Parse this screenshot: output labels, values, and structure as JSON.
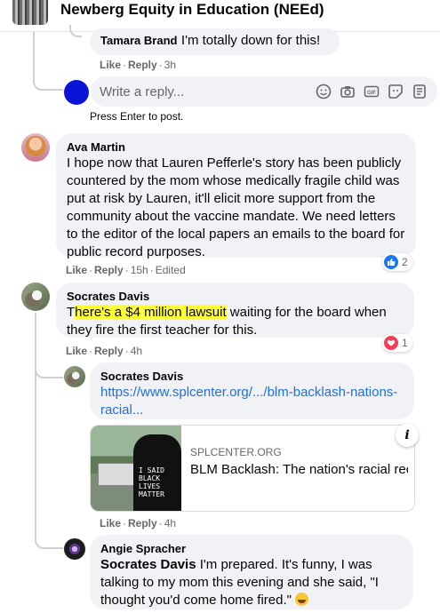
{
  "header": {
    "group_name": "Newberg Equity in Education (NEEd)"
  },
  "comments": [
    {
      "author": "Tamara Brand",
      "text": "I'm totally down for this!",
      "actions": {
        "like": "Like",
        "reply": "Reply",
        "time": "3h"
      }
    },
    {
      "author": "Ava Martin",
      "text": "I hope now that Lauren Pefferle's story has been publicly countered by the mom whose medically fragile child was put at risk by Lauren, it'll elicit more support from the community about the vaccine mandate. We need letters to the editor of the local papers an emails to the board for public record purposes.",
      "actions": {
        "like": "Like",
        "reply": "Reply",
        "time": "15h",
        "edited": "Edited"
      },
      "reaction": {
        "type": "like-icon",
        "count": "2"
      }
    },
    {
      "author": "Socrates Davis",
      "text_prefix": "T",
      "text_highlight": "here's a $4 million lawsuit",
      "text_rest": " waiting for the board when they fire the first teacher for this.",
      "actions": {
        "like": "Like",
        "reply": "Reply",
        "time": "4h"
      },
      "reaction": {
        "type": "love-icon",
        "count": "1"
      }
    },
    {
      "author": "Socrates Davis",
      "link_text": "https://www.splcenter.org/.../blm-backlash-nations-racial...",
      "link_preview": {
        "domain": "SPLCENTER.ORG",
        "title": "BLM Backlash: The nation's racial reckoning meets bitter...",
        "thumb_text": "I SAID BLACK LIVES MATTER"
      },
      "actions": {
        "like": "Like",
        "reply": "Reply",
        "time": "4h"
      }
    },
    {
      "author": "Angie Spracher",
      "mention": "Socrates Davis",
      "text": " I'm prepared. It's funny, I was talking to my mom this evening and she said, \"I thought you'd come home fired.\""
    }
  ],
  "reply_box": {
    "placeholder": "Write a reply...",
    "hint": "Press Enter to post.",
    "tools": [
      "emoji-icon",
      "camera-icon",
      "gif-icon",
      "sticker-icon",
      "avatar-sticker-icon"
    ]
  },
  "colors": {
    "link": "#216fdb",
    "bubble": "#f0f2f5",
    "highlight": "#ffff3a",
    "like": "#1877f2",
    "love": "#f33e58"
  }
}
